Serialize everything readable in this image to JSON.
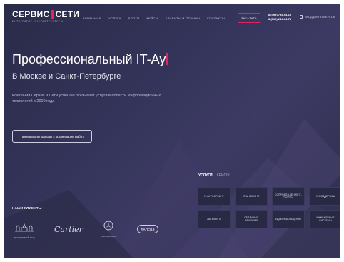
{
  "logo": {
    "text_a": "СЕРВИС",
    "text_b": "СЕТИ",
    "subtitle": "ИНТЕГРАТОР ИНФРАСТРУКТУРЫ"
  },
  "nav": {
    "items": [
      {
        "label": "КОМПАНИЯ"
      },
      {
        "label": "УСЛУГИ"
      },
      {
        "label": "БЛОГИ"
      },
      {
        "label": "КЕЙСЫ"
      },
      {
        "label": "КЛИЕНТЫ И ОТЗЫВЫ"
      },
      {
        "label": "КОНТАКТЫ"
      }
    ],
    "order_label": "ЗАКАЗАТЬ",
    "phones": [
      "8 (495) 755-94-15",
      "8 (812) 244-34-74"
    ],
    "client_login": "ВХОД ДЛЯ КЛИЕНТОВ"
  },
  "hero": {
    "title": "Профессиональный IT-Ау",
    "subtitle": "В Москве и Санкт-Петербурге",
    "description": "Компания Сервис и Сети успешно оказывает услуги в области Информационных технологий с 2009 года",
    "cta_label": "Принципы и подходы к организации работ"
  },
  "clients": {
    "heading": "НАШИ КЛИЕНТЫ",
    "logos": [
      {
        "name": "Дворцовый",
        "caption": "ДВОРЦОВЫЙ ПАЦ"
      },
      {
        "name": "Cartier"
      },
      {
        "name": "Mercedes-Benz",
        "caption": "Mercedes-Benz"
      },
      {
        "name": "ЛАПСВЭ"
      }
    ]
  },
  "services": {
    "tab_active": "УСЛУГИ",
    "tab_other": "КЕЙСЫ",
    "tiles": [
      {
        "label": "IT-АУТСОРСИНГ"
      },
      {
        "label": "IT-АНАЛИЗ IT"
      },
      {
        "label": "СОПРОВОЖДЕНИЕ IT-СИСТЕМ"
      },
      {
        "label": "IT-ПОДДЕРЖКА"
      },
      {
        "label": "ЗАКУПКИ IT"
      },
      {
        "label": "ОБЛАЧНЫЕ РЕШЕНИЯ"
      },
      {
        "label": "ВИДЕОНАБЛЮДЕНИЕ"
      },
      {
        "label": "ИНЖЕНЕРНЫЕ СИСТЕМЫ"
      }
    ]
  }
}
